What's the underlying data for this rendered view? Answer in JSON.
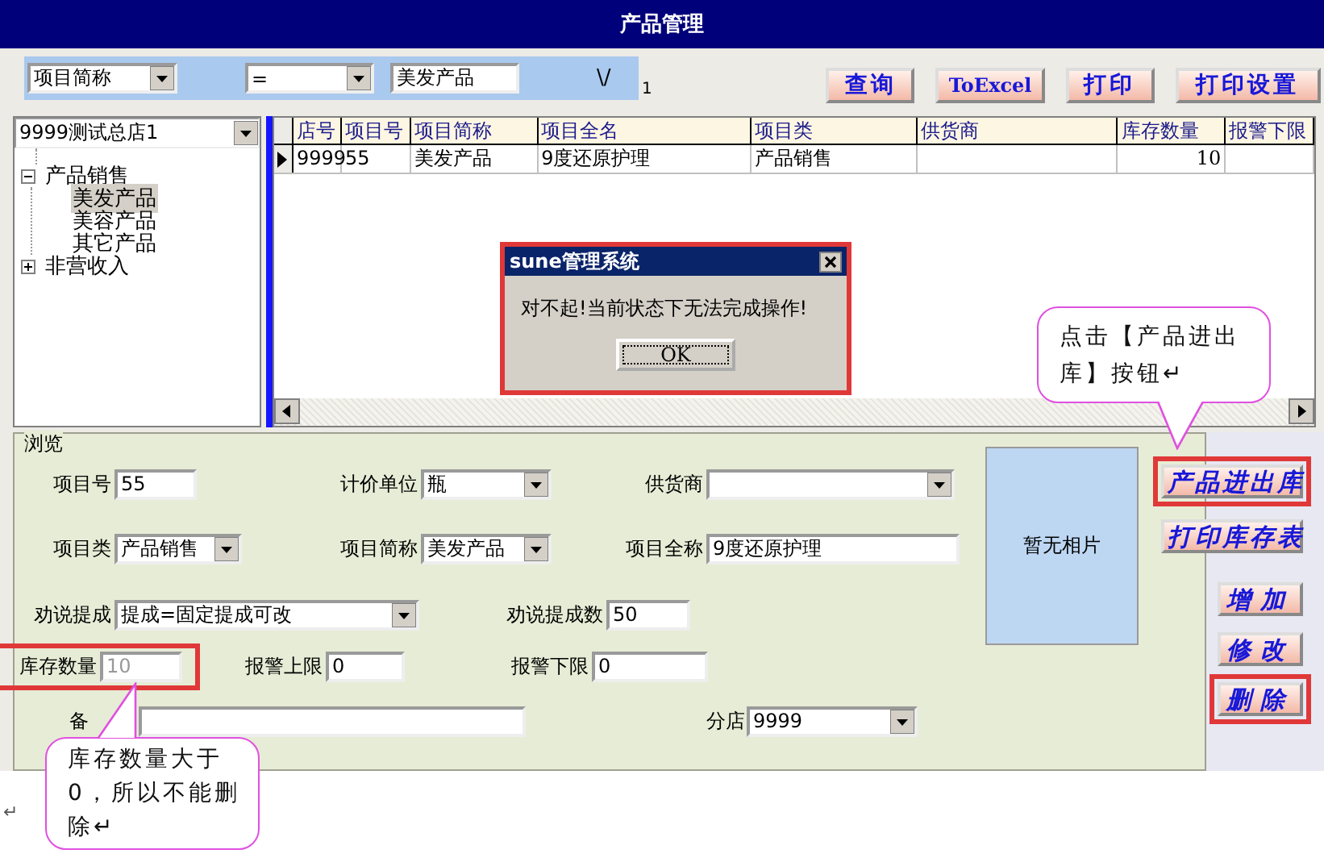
{
  "window": {
    "title": "产品管理"
  },
  "filter": {
    "field": "项目简称",
    "operator": "=",
    "value": "美发产品",
    "symbol": "\\/",
    "count": "1"
  },
  "toolbar": [
    "查询",
    "ToExcel",
    "打印",
    "打印设置"
  ],
  "store_select": "9999测试总店1",
  "tree": [
    {
      "label": "产品销售",
      "expanded": true,
      "selected": false,
      "children": [
        {
          "label": "美发产品",
          "selected": true
        },
        {
          "label": "美容产品",
          "selected": false
        },
        {
          "label": "其它产品",
          "selected": false
        }
      ]
    },
    {
      "label": "非营收入",
      "expanded": false,
      "selected": false
    }
  ],
  "grid": {
    "columns": [
      "店号",
      "项目号",
      "项目简称",
      "项目全名",
      "项目类",
      "供货商",
      "库存数量",
      "报警下限"
    ],
    "rows": [
      {
        "current": true,
        "cells": [
          "9999",
          "55",
          "美发产品",
          "9度还原护理",
          "产品销售",
          "",
          "10",
          ""
        ]
      }
    ]
  },
  "dialog": {
    "title": "sune管理系统",
    "message": "对不起!当前状态下无法完成操作!",
    "button": "OK"
  },
  "form": {
    "legend": "浏览",
    "photo": "暂无相片",
    "rows": [
      [
        {
          "label": "项目号",
          "value": "55",
          "kind": "input",
          "disabled": false,
          "highlighted": false
        },
        {
          "label": "计价单位",
          "value": "瓶",
          "kind": "select",
          "disabled": false,
          "highlighted": false
        },
        {
          "label": "供货商",
          "kind": "select",
          "disabled": false,
          "highlighted": false
        }
      ],
      [
        {
          "label": "项目类",
          "value": "产品销售",
          "kind": "select",
          "disabled": false,
          "highlighted": false
        },
        {
          "label": "项目简称",
          "value": "美发产品",
          "kind": "select",
          "disabled": false,
          "highlighted": false
        },
        {
          "label": "项目全称",
          "value": "9度还原护理",
          "kind": "input",
          "disabled": false,
          "highlighted": false
        }
      ],
      [
        {
          "label": "劝说提成",
          "value": "提成=固定提成可改",
          "kind": "select",
          "disabled": false,
          "highlighted": false
        },
        {
          "label": "劝说提成数",
          "value": "50",
          "kind": "input",
          "disabled": false,
          "highlighted": false
        }
      ],
      [
        {
          "label": "库存数量",
          "value": "10",
          "kind": "input",
          "disabled": true,
          "highlighted": true
        },
        {
          "label": "报警上限",
          "value": "0",
          "kind": "input",
          "disabled": false,
          "highlighted": false
        },
        {
          "label": "报警下限",
          "value": "0",
          "kind": "input",
          "disabled": false,
          "highlighted": false
        }
      ],
      [
        {
          "label": "备",
          "kind": "input",
          "disabled": false,
          "highlighted": false
        },
        {
          "label": "分店",
          "value": "9999",
          "kind": "select",
          "disabled": false,
          "highlighted": false
        }
      ]
    ]
  },
  "side_buttons": [
    {
      "label": "产品进出库",
      "highlighted": true
    },
    {
      "label": "打印库存表",
      "highlighted": false
    },
    {
      "label": "增加",
      "highlighted": false
    },
    {
      "label": "修改",
      "highlighted": false
    },
    {
      "label": "删除",
      "highlighted": true
    }
  ],
  "callouts": [
    {
      "text": "点击【产品进出库】按钮↵"
    },
    {
      "text": "库存数量大于0，所以不能删除↵"
    }
  ],
  "doc_mark": "↵"
}
